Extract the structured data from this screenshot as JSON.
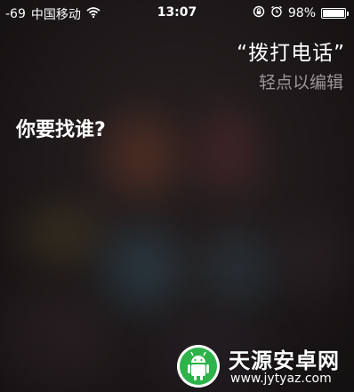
{
  "status_bar": {
    "signal": "-69",
    "carrier": "中国移动",
    "time": "13:07",
    "battery_percent": "98%",
    "battery_level": 0.98
  },
  "siri": {
    "user_query": "“拨打电话”",
    "tap_to_edit": "轻点以编辑",
    "prompt": "你要找谁?"
  },
  "watermark": {
    "site_name": "天源安卓网",
    "url": "www.jytyaz.com",
    "accent_color": "#2db34a"
  }
}
